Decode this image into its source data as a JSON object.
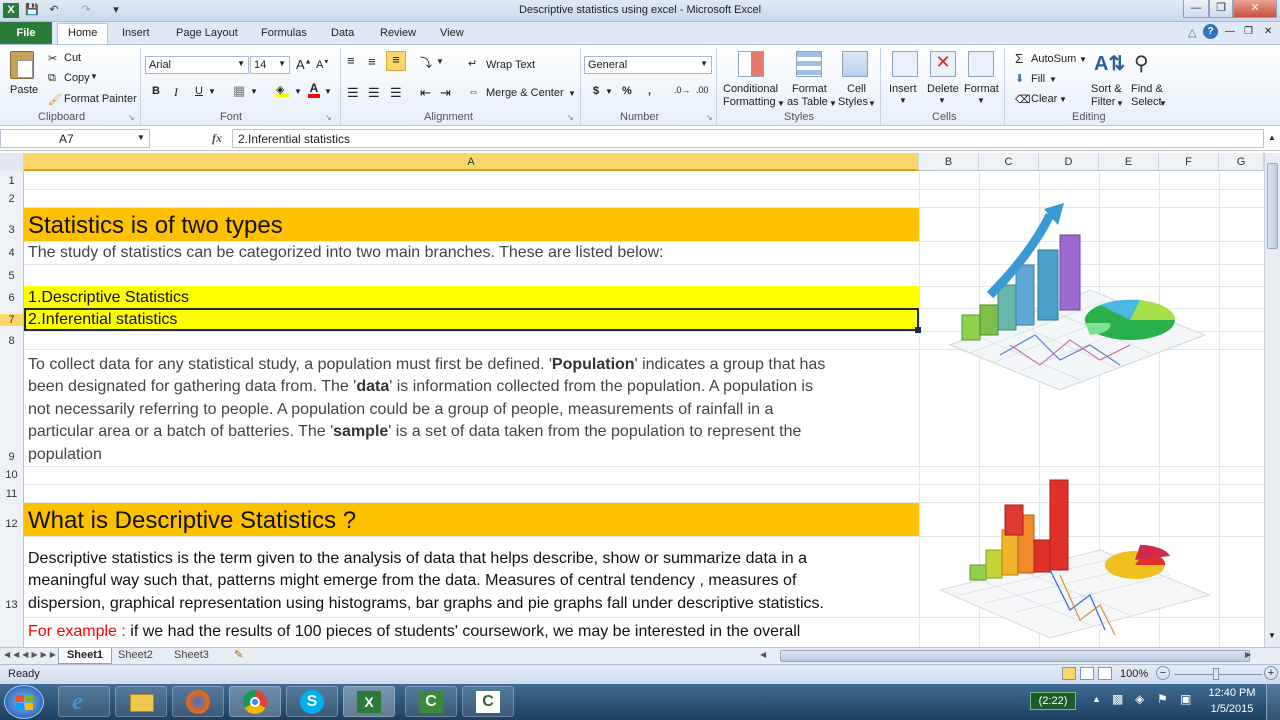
{
  "window": {
    "title": "Descriptive statistics using excel  -  Microsoft Excel"
  },
  "tabs": [
    "File",
    "Home",
    "Insert",
    "Page Layout",
    "Formulas",
    "Data",
    "Review",
    "View"
  ],
  "clipboard": {
    "paste": "Paste",
    "cut": "Cut",
    "copy": "Copy",
    "format_painter": "Format Painter",
    "label": "Clipboard"
  },
  "font": {
    "name": "Arial",
    "size": "14",
    "bold": "B",
    "italic": "I",
    "underline": "U",
    "label": "Font"
  },
  "alignment": {
    "wrap": "Wrap Text",
    "merge": "Merge & Center",
    "label": "Alignment"
  },
  "number": {
    "format": "General",
    "currency": "$",
    "percent": "%",
    "comma": ",",
    "label": "Number"
  },
  "styles": {
    "conditional": "Conditional",
    "conditional2": "Formatting",
    "format_table": "Format",
    "format_table2": "as Table",
    "cell_styles": "Cell",
    "cell_styles2": "Styles",
    "label": "Styles"
  },
  "cells": {
    "insert": "Insert",
    "delete": "Delete",
    "format": "Format",
    "label": "Cells"
  },
  "editing": {
    "autosum": "AutoSum",
    "fill": "Fill",
    "clear": "Clear",
    "sort": "Sort &",
    "sort2": "Filter",
    "find": "Find &",
    "find2": "Select",
    "label": "Editing"
  },
  "formula_bar": {
    "name_box": "A7",
    "fx": "fx",
    "value": "2.Inferential statistics"
  },
  "columns": [
    "A",
    "B",
    "C",
    "D",
    "E",
    "F",
    "G"
  ],
  "rows": [
    "1",
    "2",
    "3",
    "4",
    "5",
    "6",
    "7",
    "8",
    "9",
    "10",
    "11",
    "12",
    "13"
  ],
  "cells_text": {
    "r3": "Statistics is of two types",
    "r4": "The study of statistics can be categorized into two main branches. These are listed below:",
    "r6": "1.Descriptive Statistics",
    "r7": "2.Inferential statistics",
    "r9a_1": "To collect data for any statistical study, a population must first be defined. '",
    "r9a_b": "Population",
    "r9a_2": "' indicates a group that has",
    "r9b_1": "been designated for gathering data from. The '",
    "r9b_b": "data",
    "r9b_2": "' is information collected from the population. A population is",
    "r9c": "not necessarily referring to people. A population could be a group of people, measurements of rainfall in a",
    "r9d_1": "particular area or a batch of batteries. The '",
    "r9d_b": "sample",
    "r9d_2": "' is a set of data taken from the population to represent the",
    "r9e": "population",
    "r12": "What is Descriptive Statistics ?",
    "r13a": "Descriptive statistics is the term given to the analysis of data that helps describe, show or summarize data in a",
    "r13b": "meaningful way such that, patterns might emerge from the data. Measures of central tendency , measures of",
    "r13c": "dispersion, graphical representation using histograms, bar graphs and pie graphs fall under descriptive statistics.",
    "r14_red": "For example :",
    "r14_rest": " if we had the results of 100 pieces of students' coursework, we may be interested in the overall"
  },
  "sheets": [
    "Sheet1",
    "Sheet2",
    "Sheet3"
  ],
  "status": {
    "ready": "Ready",
    "zoom": "100%"
  },
  "taskbar": {
    "battery": "(2:22)",
    "time": "12:40 PM",
    "date": "1/5/2015"
  },
  "colors": {
    "orange_band": "#ffc000",
    "yellow_band": "#ffff00",
    "excel_green": "#2a7a3a",
    "red_text": "#ff0000"
  }
}
